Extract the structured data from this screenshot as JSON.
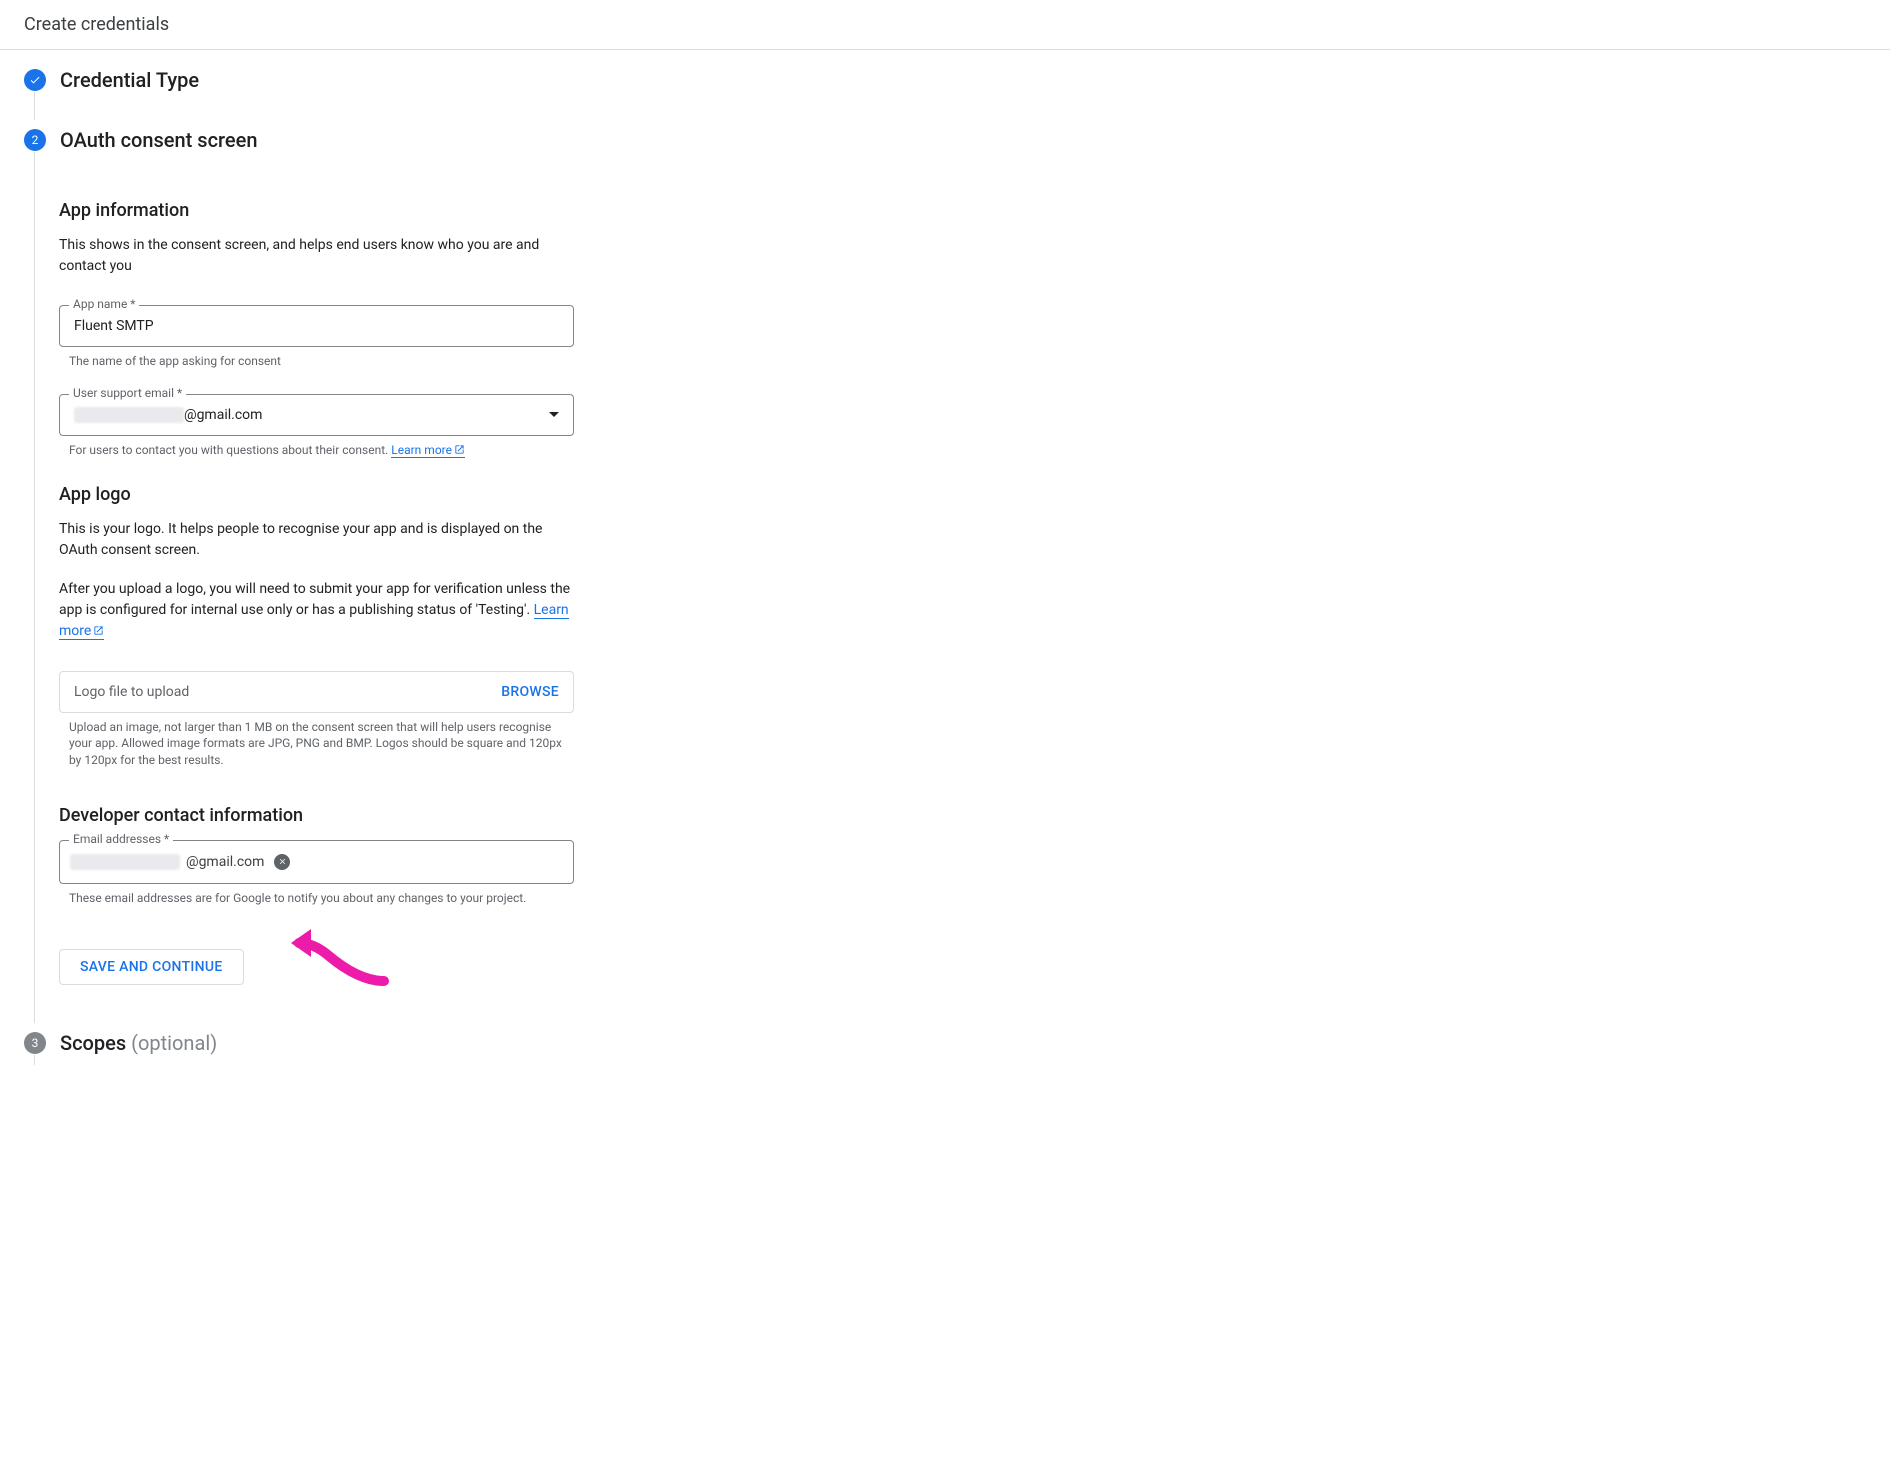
{
  "header": {
    "title": "Create credentials"
  },
  "steps": {
    "credential_type": {
      "title": "Credential Type"
    },
    "oauth_consent": {
      "number": "2",
      "title": "OAuth consent screen"
    },
    "scopes": {
      "number": "3",
      "title": "Scopes",
      "optional_label": "(optional)"
    }
  },
  "app_info": {
    "title": "App information",
    "description": "This shows in the consent screen, and helps end users know who you are and contact you",
    "app_name": {
      "label": "App name *",
      "value": "Fluent SMTP",
      "helper": "The name of the app asking for consent"
    },
    "support_email": {
      "label": "User support email *",
      "value_suffix": "@gmail.com",
      "helper_prefix": "For users to contact you with questions about their consent. ",
      "learn_more": "Learn more"
    }
  },
  "app_logo": {
    "title": "App logo",
    "description_p1": "This is your logo. It helps people to recognise your app and is displayed on the OAuth consent screen.",
    "description_p2_prefix": "After you upload a logo, you will need to submit your app for verification unless the app is configured for internal use only or has a publishing status of 'Testing'. ",
    "learn_more": "Learn more",
    "file_placeholder": "Logo file to upload",
    "browse_label": "BROWSE",
    "helper": "Upload an image, not larger than 1 MB on the consent screen that will help users recognise your app. Allowed image formats are JPG, PNG and BMP. Logos should be square and 120px by 120px for the best results."
  },
  "developer_contact": {
    "title": "Developer contact information",
    "label": "Email addresses *",
    "chip_suffix": "@gmail.com",
    "helper": "These email addresses are for Google to notify you about any changes to your project."
  },
  "actions": {
    "save_continue": "SAVE AND CONTINUE"
  }
}
